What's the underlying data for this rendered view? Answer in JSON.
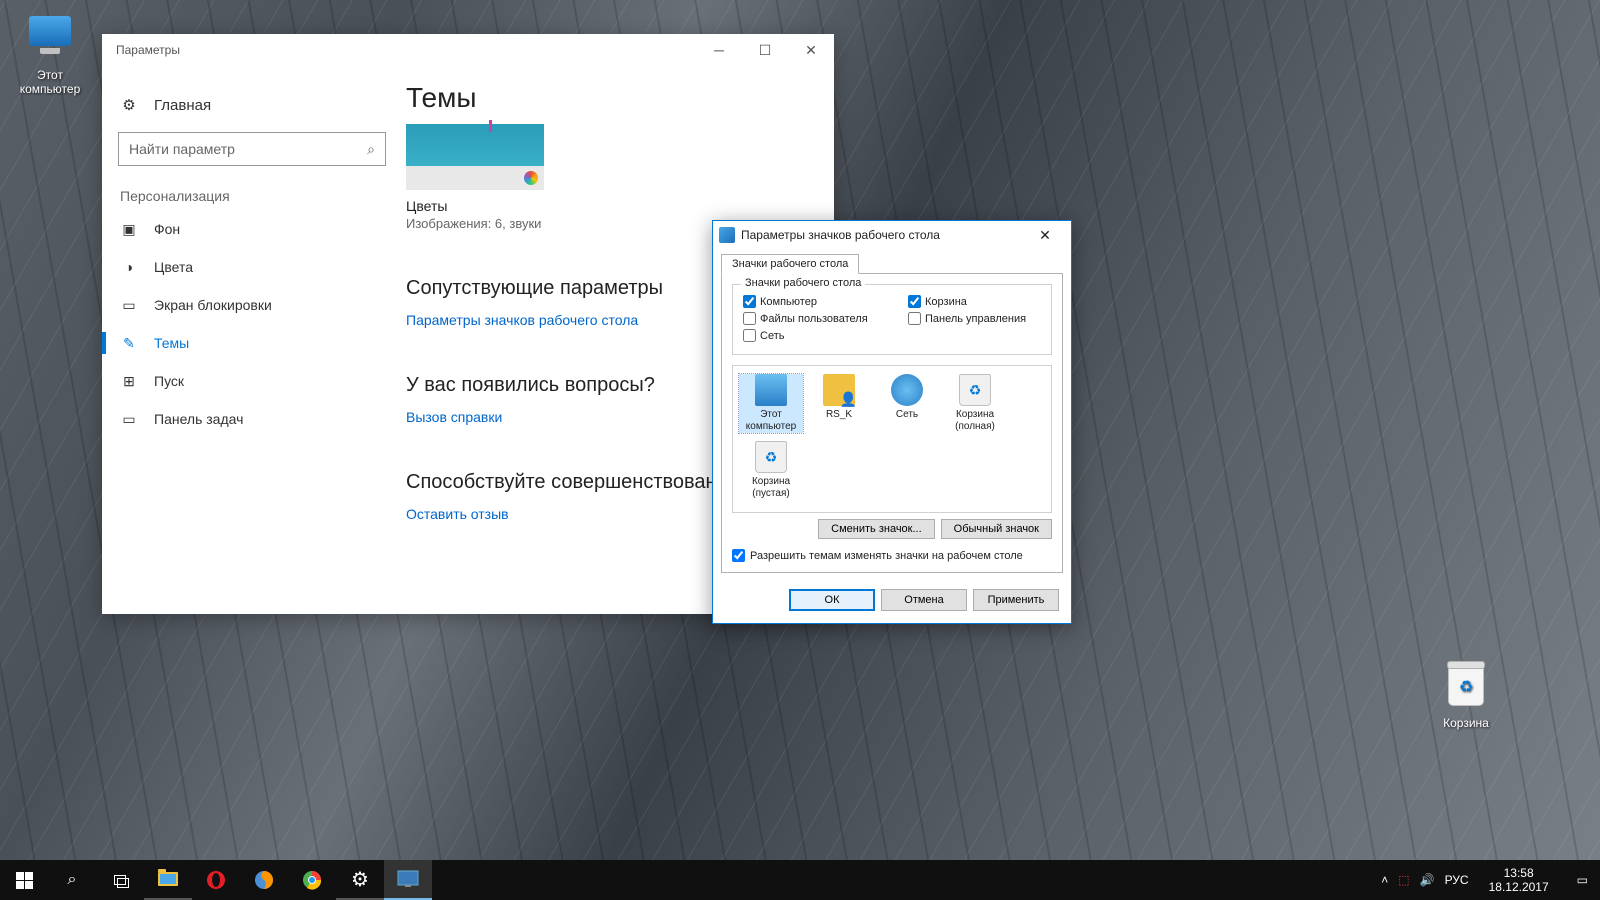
{
  "desktop_icons": {
    "this_pc": "Этот компьютер",
    "recycle": "Корзина"
  },
  "settings": {
    "window_title": "Параметры",
    "home": "Главная",
    "search_placeholder": "Найти параметр",
    "section": "Персонализация",
    "nav": {
      "background": "Фон",
      "colors": "Цвета",
      "lockscreen": "Экран блокировки",
      "themes": "Темы",
      "start": "Пуск",
      "taskbar": "Панель задач"
    },
    "content": {
      "heading": "Темы",
      "theme_name": "Цветы",
      "theme_sub": "Изображения: 6, звуки",
      "related_heading": "Сопутствующие параметры",
      "related_link": "Параметры значков рабочего стола",
      "questions_heading": "У вас появились вопросы?",
      "questions_link": "Вызов справки",
      "feedback_heading": "Способствуйте совершенствованию",
      "feedback_link": "Оставить отзыв"
    }
  },
  "dialog": {
    "title": "Параметры значков рабочего стола",
    "tab": "Значки рабочего стола",
    "group_title": "Значки рабочего стола",
    "checkboxes": {
      "computer": "Компьютер",
      "recycle": "Корзина",
      "userfiles": "Файлы пользователя",
      "cpanel": "Панель управления",
      "network": "Сеть"
    },
    "icons": {
      "this_pc": "Этот компьютер",
      "user": "RS_K",
      "network": "Сеть",
      "bin_full": "Корзина (полная)",
      "bin_empty": "Корзина (пустая)"
    },
    "change_icon": "Сменить значок...",
    "default_icon": "Обычный значок",
    "allow_themes": "Разрешить темам изменять значки на рабочем столе",
    "ok": "ОК",
    "cancel": "Отмена",
    "apply": "Применить"
  },
  "taskbar": {
    "lang": "РУС",
    "time": "13:58",
    "date": "18.12.2017"
  }
}
